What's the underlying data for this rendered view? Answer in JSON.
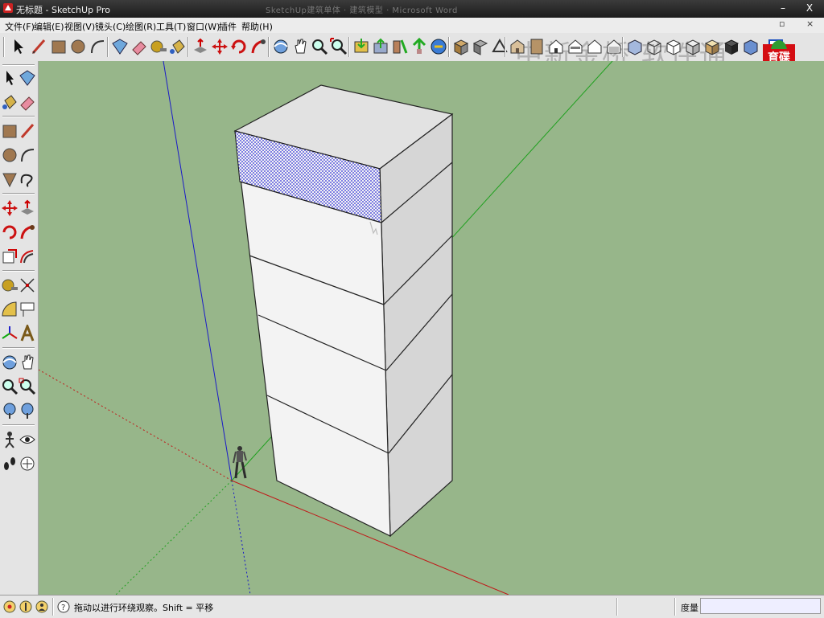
{
  "window": {
    "title": "无标题 - SketchUp Pro",
    "ghost_caption": "SketchUp建筑单体 · 建筑模型 · Microsoft Word",
    "minimize_glyph": "–",
    "close_glyph": "X"
  },
  "menubar": {
    "items": [
      "文件(F)",
      "编辑(E)",
      "视图(V)",
      "镜头(C)",
      "绘图(R)",
      "工具(T)",
      "窗口(W)",
      "插件",
      "帮助(H)"
    ],
    "mdi_restore_glyph": "▫",
    "mdi_close_glyph": "×"
  },
  "toolbar": {
    "watermark_text": "中新金桥 软件通",
    "logo_text_line1": "育碟",
    "logo_text_line2": "软件",
    "buttons": [
      "select-icon",
      "line-icon",
      "rectangle-icon",
      "circle-icon",
      "arc-icon",
      "make-component-icon",
      "eraser-icon",
      "tape-measure-icon",
      "paint-bucket-icon",
      "push-pull-icon",
      "move-icon",
      "rotate-icon",
      "follow-me-icon",
      "orbit-icon",
      "pan-icon",
      "zoom-icon",
      "zoom-extents-icon",
      "get-models-icon",
      "share-model-icon",
      "preview-in-google-earth-icon",
      "get-photo-texture-icon",
      "share-component-icon",
      "component-3d-icon",
      "profile-icon",
      "iso-view-icon",
      "top-view-icon",
      "front-view-icon",
      "right-view-icon",
      "back-view-icon",
      "left-view-icon",
      "xray-style-icon",
      "wireframe-style-icon",
      "hidden-line-style-icon",
      "shaded-style-icon",
      "shaded-textures-style-icon",
      "monochrome-style-icon",
      "section-plane-icon"
    ]
  },
  "palette": {
    "tools": [
      "select-icon",
      "make-component-icon",
      "paint-bucket-icon",
      "eraser-icon",
      "rectangle-icon",
      "line-icon",
      "circle-icon",
      "arc-icon",
      "polygon-icon",
      "freehand-icon",
      "move-icon",
      "push-pull-icon",
      "rotate-icon",
      "follow-me-icon",
      "scale-icon",
      "offset-icon",
      "tape-measure-icon",
      "dimension-icon",
      "protractor-icon",
      "text-icon",
      "axes-icon",
      "3d-text-icon",
      "orbit-icon",
      "pan-icon",
      "zoom-icon",
      "zoom-window-icon",
      "previous-view-icon",
      "next-view-icon",
      "position-camera-icon",
      "look-around-icon",
      "walk-icon",
      "section-plane-icon"
    ]
  },
  "statusbar": {
    "hint": "拖动以进行环绕观察。Shift = 平移",
    "measure_label": "度量",
    "measure_value": ""
  },
  "colors": {
    "viewport_bg": "#97b68a",
    "face_front": "#f3f3f3",
    "face_side": "#d6d6d6",
    "face_top": "#e2e2e2",
    "selection_blue": "#2a2ad8",
    "axis_red": "#c01818",
    "axis_green": "#1fa01f",
    "axis_blue": "#1a1ac8"
  }
}
